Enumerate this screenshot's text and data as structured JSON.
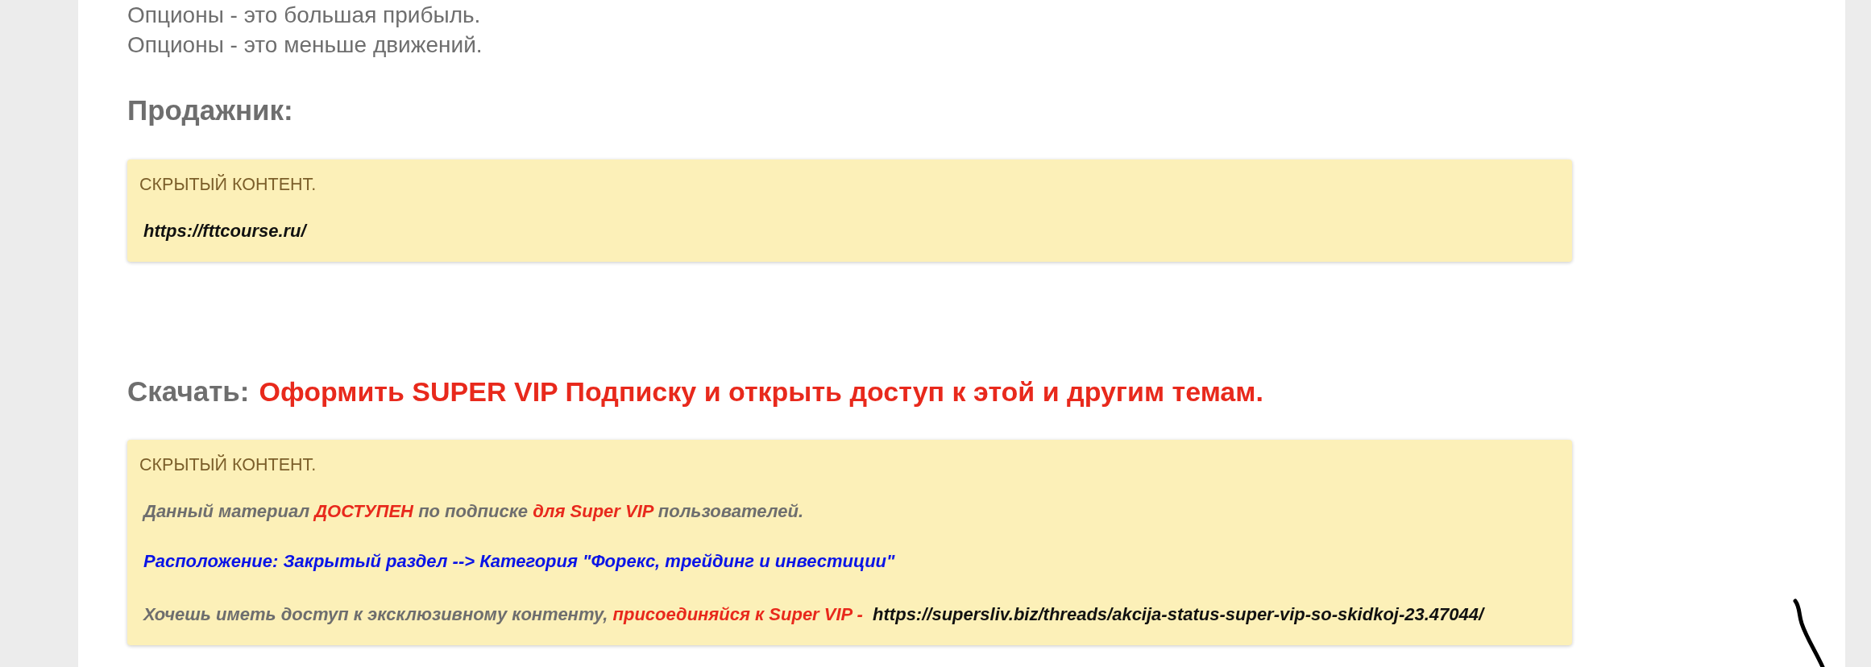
{
  "intro_lines": [
    "Опционы - это большая прибыль.",
    "Опционы - это меньше движений."
  ],
  "seller_heading": "Продажник:",
  "seller_box": {
    "label": "СКРЫТЫЙ КОНТЕНТ.",
    "lines": [
      [
        {
          "kind": "link",
          "text": "https://fttcourse.ru/"
        }
      ]
    ]
  },
  "download_heading": {
    "label": "Скачать:",
    "link": "Оформить SUPER VIP Подписку и открыть доступ к этой и другим темам."
  },
  "download_box": {
    "label": "СКРЫТЫЙ КОНТЕНТ.",
    "lines": [
      [
        {
          "kind": "plain",
          "text": "Данный материал "
        },
        {
          "kind": "accent",
          "text": "ДОСТУПЕН"
        },
        {
          "kind": "plain",
          "text": " по подписке "
        },
        {
          "kind": "accent",
          "text": "для Super VIP"
        },
        {
          "kind": "plain",
          "text": " пользователей."
        }
      ],
      [
        {
          "kind": "location",
          "text": "Расположение: Закрытый раздел --> Категория \"Форекс, трейдинг и инвестиции\""
        }
      ],
      [
        {
          "kind": "plain",
          "text": "Хочешь иметь доступ к эксклюзивному контенту, "
        },
        {
          "kind": "accent",
          "text": "присоединяйся к Super VIP - "
        },
        {
          "kind": "link",
          "text": " https://supersliv.biz/threads/akcija-status-super-vip-so-skidkoj-23.47044/"
        }
      ]
    ]
  }
}
